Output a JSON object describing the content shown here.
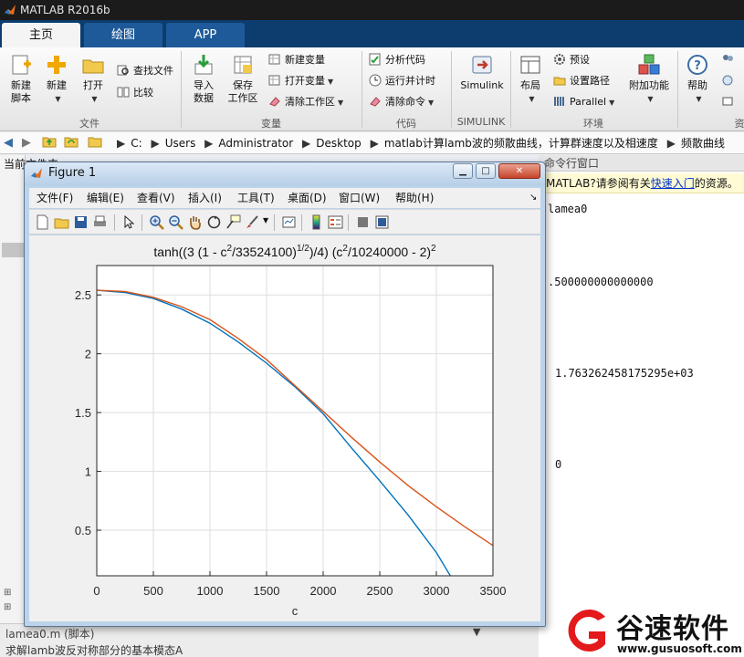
{
  "app": {
    "title": "MATLAB R2016b"
  },
  "tabs": [
    {
      "label": "主页",
      "active": true
    },
    {
      "label": "绘图",
      "active": false
    },
    {
      "label": "APP",
      "active": false
    }
  ],
  "ribbon": {
    "file": {
      "label": "文件",
      "new_script": "新建\n脚本",
      "new": "新建",
      "open": "打开",
      "find_files": "查找文件",
      "compare": "比较"
    },
    "variable": {
      "label": "变量",
      "import": "导入\n数据",
      "save_workspace": "保存\n工作区",
      "new_variable": "新建变量",
      "open_variable": "打开变量",
      "clear_workspace": "清除工作区"
    },
    "code": {
      "label": "代码",
      "analyze": "分析代码",
      "run_and_time": "运行并计时",
      "clear_commands": "清除命令"
    },
    "simulink": {
      "label": "SIMULINK",
      "button": "Simulink"
    },
    "environment": {
      "label": "环境",
      "layout": "布局",
      "preferences": "预设",
      "set_path": "设置路径",
      "parallel": "Parallel",
      "addons": "附加功能"
    },
    "resources": {
      "label": "资",
      "help": "帮助"
    }
  },
  "address": {
    "crumbs": [
      "C:",
      "Users",
      "Administrator",
      "Desktop",
      "matlab计算lamb波的频散曲线，计算群速度以及相速度",
      "频散曲线"
    ]
  },
  "left_panel": {
    "title": "当前文件夹"
  },
  "command_window": {
    "title": "命令行窗口",
    "notice_prefix": "MATLAB?请参阅有关",
    "notice_link": "快速入门",
    "notice_suffix": "的资源。",
    "lines": [
      "lamea0",
      ".500000000000000",
      "1.763262458175295e+03",
      "0"
    ]
  },
  "bottom": {
    "file_label": "lamea0.m  (脚本)",
    "desc": "求解lamb波反对称部分的基本模态A"
  },
  "figure": {
    "title": "Figure 1",
    "menu": [
      "文件(F)",
      "编辑(E)",
      "查看(V)",
      "插入(I)",
      "工具(T)",
      "桌面(D)",
      "窗口(W)",
      "帮助(H)"
    ]
  },
  "chart_data": {
    "type": "line",
    "title_parts": [
      "tanh((3 (1 - c",
      "2",
      "/33524100)",
      "1/2",
      ")/4) (c",
      "2",
      "/10240000 - 2)",
      "2"
    ],
    "xlabel": "c",
    "ylabel": "",
    "xlim": [
      0,
      3500
    ],
    "ylim": [
      0.1125,
      2.75
    ],
    "xticks": [
      0,
      500,
      1000,
      1500,
      2000,
      2500,
      3000,
      3500
    ],
    "yticks": [
      0.5,
      1,
      1.5,
      2,
      2.5
    ],
    "grid": true,
    "series": [
      {
        "color": "#0072BD",
        "x": [
          0,
          250,
          500,
          750,
          1000,
          1250,
          1500,
          1750,
          2000,
          2250,
          2500,
          2750,
          3000,
          3125
        ],
        "y": [
          2.54,
          2.52,
          2.47,
          2.38,
          2.26,
          2.1,
          1.92,
          1.72,
          1.49,
          1.2,
          0.92,
          0.63,
          0.31,
          0.11
        ]
      },
      {
        "color": "#D95319",
        "x": [
          0,
          250,
          500,
          750,
          1000,
          1250,
          1500,
          1750,
          2000,
          2250,
          2500,
          2750,
          3000,
          3250,
          3500
        ],
        "y": [
          2.54,
          2.53,
          2.48,
          2.4,
          2.29,
          2.13,
          1.95,
          1.73,
          1.51,
          1.29,
          1.08,
          0.88,
          0.7,
          0.53,
          0.37
        ]
      }
    ]
  },
  "watermark": {
    "text": "谷速软件",
    "url": "www.gusuosoft.com"
  },
  "colors": {
    "matlab_blue": "#0072BD",
    "matlab_orange": "#D95319",
    "tab_strip": "#0d3c6e"
  }
}
